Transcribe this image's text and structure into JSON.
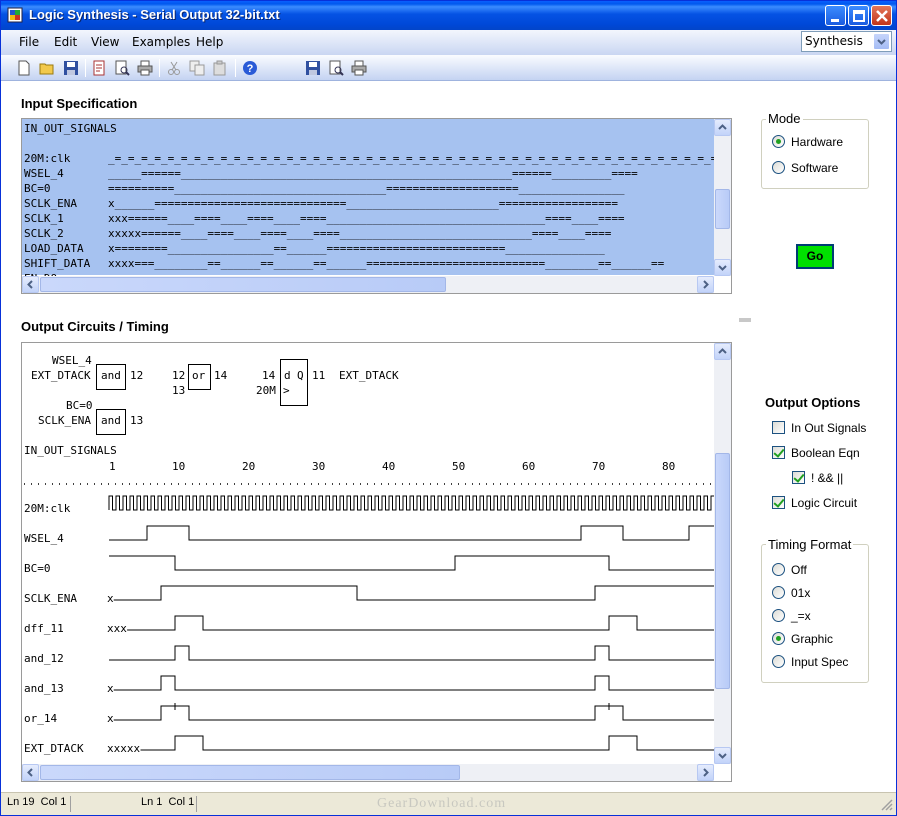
{
  "window": {
    "title": "Logic Synthesis - Serial Output 32-bit.txt"
  },
  "menu": [
    "File",
    "Edit",
    "View",
    "Examples",
    "Help"
  ],
  "mode_dropdown": {
    "value": "Synthesis"
  },
  "input_spec": {
    "title": "Input Specification",
    "lines": [
      {
        "label": "IN_OUT_SIGNALS",
        "wave": ""
      },
      {
        "label": "",
        "wave": ""
      },
      {
        "label": "20M:clk",
        "wave": "_=_=_=_=_=_=_=_=_=_=_=_=_=_=_=_=_=_=_=_=_=_=_=_=_=_=_=_=_=_=_=_=_=_=_=_=_=_=_=_=_=_=_=_=_=_=_=_="
      },
      {
        "label": "WSEL_4",
        "wave": "_____======__________________________________________________======_________===="
      },
      {
        "label": "BC=0",
        "wave": "==========________________________________====================________________"
      },
      {
        "label": "SCLK_ENA",
        "wave": "x______=============================_______________________=================="
      },
      {
        "label": "SCLK_1",
        "wave": "xxx======____====____====____====_________________________________====____===="
      },
      {
        "label": "SCLK_2",
        "wave": "xxxxx======____====____====____====_____________________________====____===="
      },
      {
        "label": "LOAD_DATA",
        "wave": "x========________________==______===========================_______________"
      },
      {
        "label": "SHIFT_DATA",
        "wave": "xxxx===________==______==______==______===========================________==______=="
      },
      {
        "label": "EN_DO",
        "wave": ""
      }
    ]
  },
  "output": {
    "title": "Output Circuits / Timing",
    "circuit": {
      "and1_in1": "WSEL_4",
      "and1_in2": "EXT_DTACK",
      "and1_label": "and",
      "and1_out": "12",
      "or_in1": "12",
      "or_in2": "13",
      "or_label": "or",
      "or_out": "14",
      "ff_in": "14",
      "ff_clk": "20M",
      "ff_d": "d",
      "ff_q": "Q",
      "ff_clk_mark": ">",
      "ff_out": "11",
      "ff_out_name": "EXT_DTACK",
      "and2_in1": "BC=0",
      "and2_in2": "SCLK_ENA",
      "and2_label": "and",
      "and2_out": "13"
    },
    "timing_header": "IN_OUT_SIGNALS",
    "ruler": [
      "1",
      "10",
      "20",
      "30",
      "40",
      "50",
      "60",
      "70",
      "80"
    ],
    "signals": [
      {
        "name": "20M:clk",
        "prefix": "",
        "edges": []
      },
      {
        "name": "WSEL_4",
        "prefix": "",
        "edges": [
          [
            0,
            0
          ],
          [
            38,
            1
          ],
          [
            80,
            0
          ],
          [
            472,
            1
          ],
          [
            514,
            0
          ],
          [
            580,
            1
          ]
        ]
      },
      {
        "name": "BC=0",
        "prefix": "",
        "edges": [
          [
            0,
            1
          ],
          [
            66,
            0
          ],
          [
            346,
            1
          ],
          [
            500,
            0
          ]
        ]
      },
      {
        "name": "SCLK_ENA",
        "prefix": "x",
        "edges": [
          [
            0,
            0
          ],
          [
            52,
            1
          ],
          [
            248,
            0
          ],
          [
            486,
            1
          ]
        ]
      },
      {
        "name": "dff_11",
        "prefix": "xxx",
        "edges": [
          [
            0,
            0
          ],
          [
            66,
            1
          ],
          [
            94,
            0
          ],
          [
            500,
            1
          ],
          [
            528,
            0
          ]
        ]
      },
      {
        "name": "and_12",
        "prefix": "",
        "edges": [
          [
            0,
            0
          ],
          [
            66,
            1
          ],
          [
            80,
            0
          ],
          [
            486,
            1
          ],
          [
            500,
            0
          ]
        ]
      },
      {
        "name": "and_13",
        "prefix": "x",
        "edges": [
          [
            0,
            0
          ],
          [
            52,
            1
          ],
          [
            66,
            0
          ],
          [
            486,
            1
          ],
          [
            500,
            0
          ]
        ]
      },
      {
        "name": "or_14",
        "prefix": "x",
        "edges": [
          [
            0,
            0
          ],
          [
            52,
            1
          ],
          [
            80,
            0
          ],
          [
            486,
            1
          ],
          [
            514,
            0
          ]
        ],
        "glitches": [
          66,
          500
        ]
      },
      {
        "name": "EXT_DTACK",
        "prefix": "xxxxx",
        "edges": [
          [
            0,
            0
          ],
          [
            66,
            1
          ],
          [
            94,
            0
          ],
          [
            500,
            1
          ],
          [
            528,
            0
          ]
        ]
      }
    ]
  },
  "mode_group": {
    "label": "Mode",
    "options": [
      "Hardware",
      "Software"
    ],
    "selected": "Hardware"
  },
  "go_button": {
    "label": "Go"
  },
  "output_options": {
    "title": "Output Options",
    "items": [
      {
        "label": "In Out Signals",
        "checked": false
      },
      {
        "label": "Boolean Eqn",
        "checked": true
      },
      {
        "label": "! && ||",
        "checked": true
      },
      {
        "label": "Logic Circuit",
        "checked": true
      }
    ]
  },
  "timing_format": {
    "label": "Timing Format",
    "options": [
      "Off",
      "01x",
      "_=x",
      "Graphic",
      "Input Spec"
    ],
    "selected": "Graphic"
  },
  "status": {
    "left_ln": "Ln 19",
    "left_col": "Col 1",
    "right_ln": "Ln 1",
    "right_col": "Col 1"
  },
  "colors": {
    "accent_go": "#00E000",
    "selection": "#A6C2F0",
    "titlebar": "#0054E3"
  }
}
